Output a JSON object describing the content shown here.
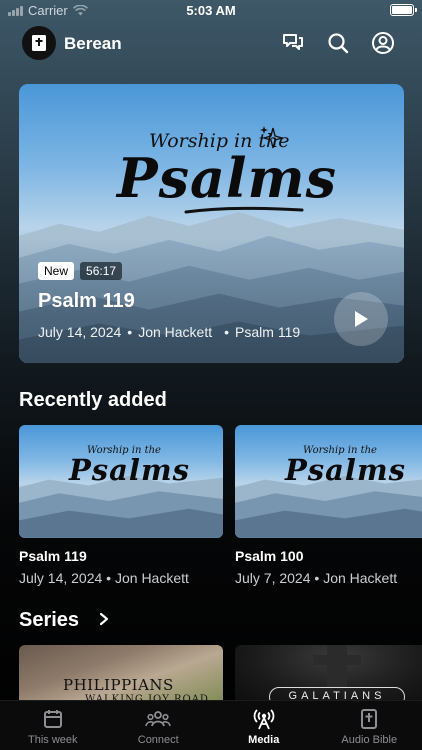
{
  "status_bar": {
    "carrier": "Carrier",
    "time": "5:03 AM"
  },
  "header": {
    "app_name": "Berean",
    "icons": [
      "chat-bubbles-icon",
      "search-icon",
      "profile-icon"
    ]
  },
  "hero": {
    "art_subtitle": "Worship in the",
    "art_title": "Psalms",
    "badge_new": "New",
    "duration": "56:17",
    "title": "Psalm 119",
    "date": "July 14, 2024",
    "speaker": "Jon Hackett",
    "series": "Psalm 119"
  },
  "recently_added": {
    "title": "Recently added",
    "items": [
      {
        "art_subtitle": "Worship in the",
        "art_title": "Psalms",
        "title": "Psalm 119",
        "date": "July 14, 2024",
        "speaker": "Jon Hackett"
      },
      {
        "art_subtitle": "Worship in the",
        "art_title": "Psalms",
        "title": "Psalm 100",
        "date": "July 7, 2024",
        "speaker": "Jon Hackett"
      }
    ]
  },
  "series": {
    "title": "Series",
    "items": [
      {
        "title": "PHILIPPIANS",
        "subtitle": "WALKING JOY ROAD"
      },
      {
        "title": "GALATIANS"
      }
    ]
  },
  "tabbar": {
    "active": "Media",
    "items": [
      {
        "label": "This week",
        "icon": "calendar-icon"
      },
      {
        "label": "Connect",
        "icon": "people-icon"
      },
      {
        "label": "Media",
        "icon": "broadcast-icon"
      },
      {
        "label": "Audio Bible",
        "icon": "bible-icon"
      }
    ]
  }
}
